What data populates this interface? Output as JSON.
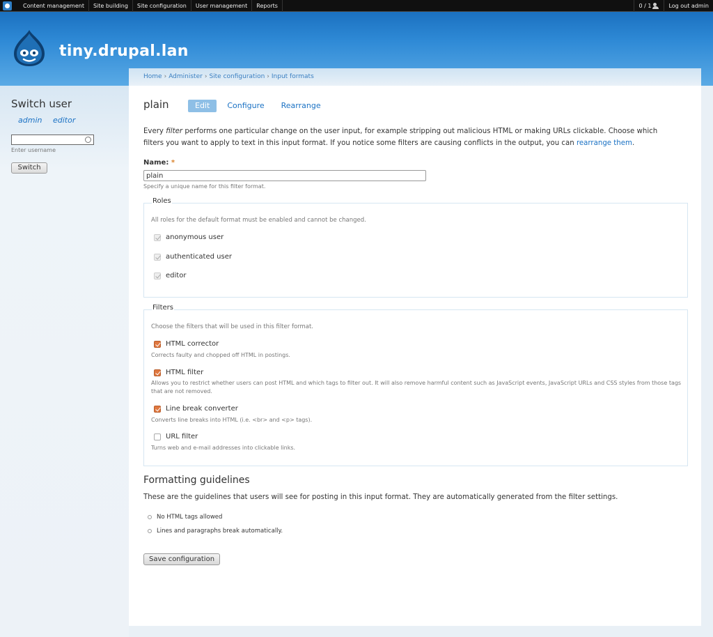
{
  "admin_menu": {
    "items": [
      "Content management",
      "Site building",
      "Site configuration",
      "User management",
      "Reports"
    ],
    "user_count": "0 / 1",
    "logout": "Log out admin"
  },
  "header": {
    "site_name": "tiny.drupal.lan"
  },
  "sidebar": {
    "title": "Switch user",
    "user_links": [
      "admin",
      "editor"
    ],
    "username_value": "",
    "username_hint": "Enter username",
    "switch_label": "Switch"
  },
  "breadcrumb": [
    "Home",
    "Administer",
    "Site configuration",
    "Input formats"
  ],
  "page": {
    "title": "plain",
    "tabs": [
      "Edit",
      "Configure",
      "Rearrange"
    ],
    "active_tab": "Edit",
    "intro_part1": "Every ",
    "intro_em": "filter",
    "intro_part2": " performs one particular change on the user input, for example stripping out malicious HTML or making URLs clickable. Choose which filters you want to apply to text in this input format. If you notice some filters are causing conflicts in the output, you can ",
    "intro_link": "rearrange them",
    "intro_end": "."
  },
  "name_field": {
    "label": "Name:",
    "required_marker": "*",
    "value": "plain",
    "description": "Specify a unique name for this filter format."
  },
  "roles": {
    "legend": "Roles",
    "description": "All roles for the default format must be enabled and cannot be changed.",
    "items": [
      "anonymous user",
      "authenticated user",
      "editor"
    ]
  },
  "filters": {
    "legend": "Filters",
    "description": "Choose the filters that will be used in this filter format.",
    "items": [
      {
        "label": "HTML corrector",
        "checked": true,
        "description": "Corrects faulty and chopped off HTML in postings."
      },
      {
        "label": "HTML filter",
        "checked": true,
        "description": "Allows you to restrict whether users can post HTML and which tags to filter out. It will also remove harmful content such as JavaScript events, JavaScript URLs and CSS styles from those tags that are not removed."
      },
      {
        "label": "Line break converter",
        "checked": true,
        "description": "Converts line breaks into HTML (i.e. <br> and <p> tags)."
      },
      {
        "label": "URL filter",
        "checked": false,
        "description": "Turns web and e-mail addresses into clickable links."
      }
    ]
  },
  "guidelines": {
    "title": "Formatting guidelines",
    "intro": "These are the guidelines that users will see for posting in this input format. They are automatically generated from the filter settings.",
    "items": [
      "No HTML tags allowed",
      "Lines and paragraphs break automatically."
    ]
  },
  "save_label": "Save configuration",
  "colors": {
    "link": "#1b72c4",
    "header_blue": "#2f8ad6",
    "checked_orange": "#e07840",
    "active_tab": "#8ebfe6"
  }
}
